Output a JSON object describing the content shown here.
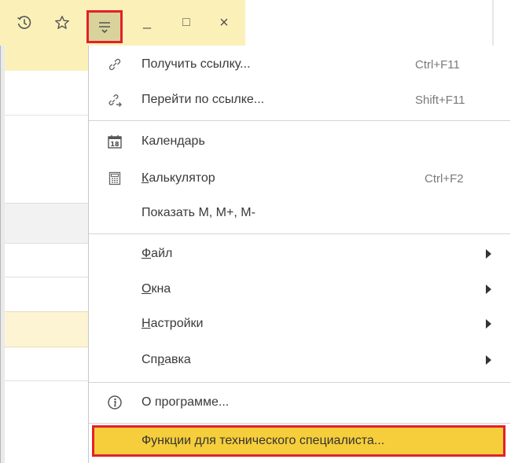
{
  "titlebar": {
    "icons": [
      "history-icon",
      "star-icon",
      "main-menu-icon",
      "minimize-icon",
      "maximize-icon",
      "close-icon"
    ],
    "minimize_glyph": "_",
    "maximize_glyph": "□",
    "close_glyph": "×"
  },
  "left_pane": {
    "search_clear": "×"
  },
  "menu": {
    "items": [
      {
        "label": "Получить ссылку...",
        "shortcut": "Ctrl+F11",
        "icon": "link-icon"
      },
      {
        "label": "Перейти по ссылке...",
        "shortcut": "Shift+F11",
        "icon": "follow-link-icon"
      },
      {
        "label_pre": "Кален",
        "label_u": "д",
        "label_post": "арь",
        "icon": "calendar-icon",
        "calendar_num": "18"
      },
      {
        "label_pre": "",
        "label_u": "К",
        "label_post": "алькулятор",
        "shortcut": "Ctrl+F2",
        "icon": "calculator-icon"
      },
      {
        "label": "Показать M, M+, M-"
      },
      {
        "label_pre": "",
        "label_u": "Ф",
        "label_post": "айл"
      },
      {
        "label_pre": "",
        "label_u": "О",
        "label_post": "кна"
      },
      {
        "label_pre": "",
        "label_u": "Н",
        "label_post": "астройки"
      },
      {
        "label_pre": "Сп",
        "label_u": "р",
        "label_post": "авка"
      },
      {
        "label": "О программе...",
        "icon": "info-icon"
      },
      {
        "label": "Функции для технического специалиста..."
      }
    ]
  },
  "colors": {
    "titlebar_bg": "#fbf1b8",
    "highlight": "#e3202a",
    "tech_item_bg": "#f6ce3b"
  }
}
